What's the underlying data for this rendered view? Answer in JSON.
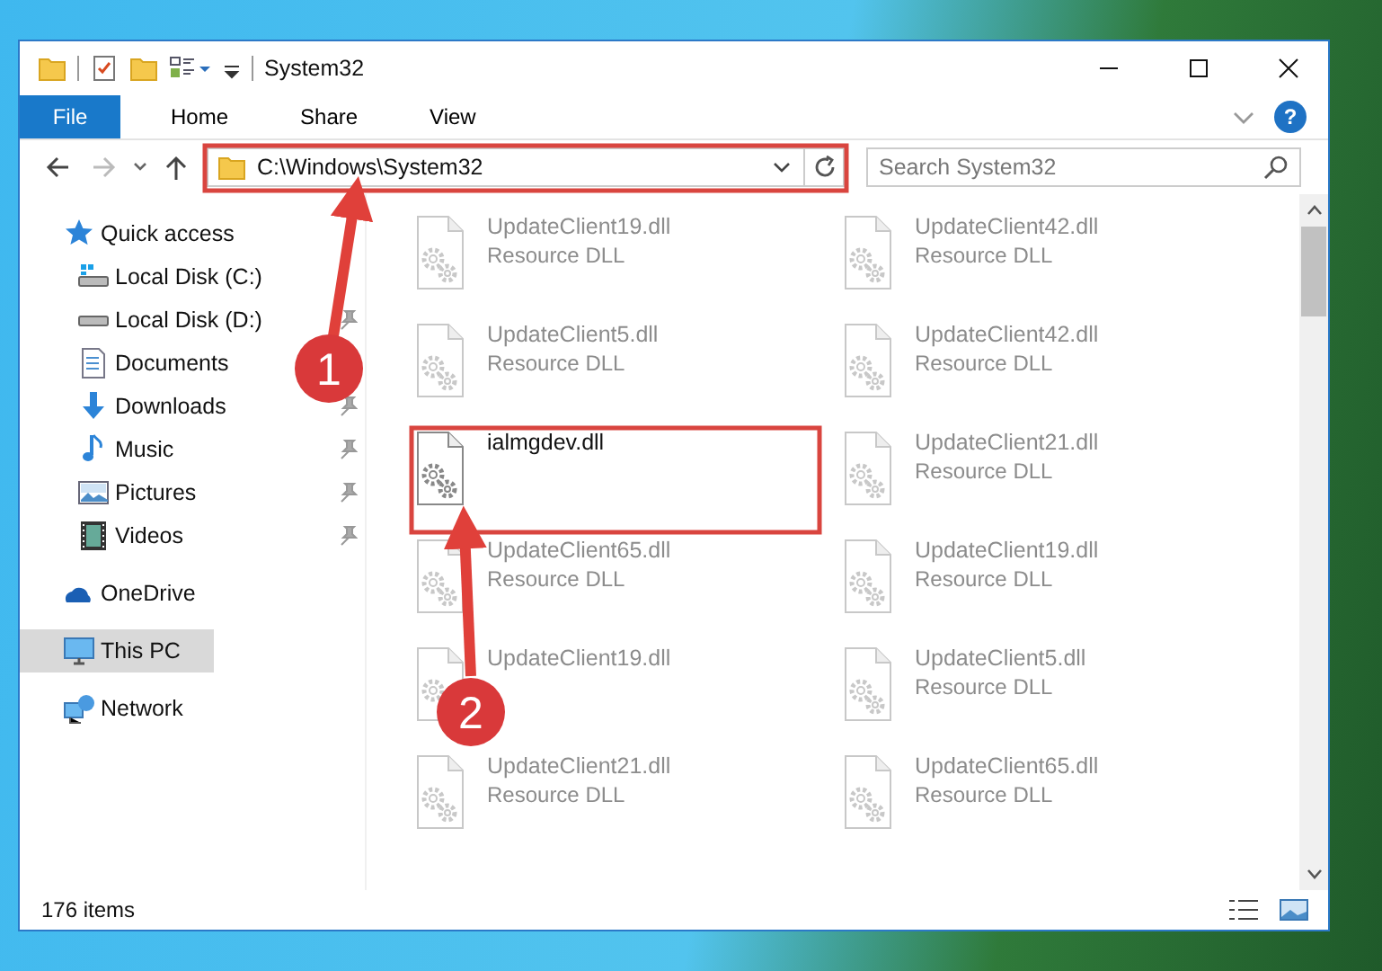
{
  "window": {
    "title": "System32"
  },
  "ribbon_tabs": [
    {
      "label": "File",
      "kind": "file"
    },
    {
      "label": "Home",
      "kind": "tab"
    },
    {
      "label": "Share",
      "kind": "tab"
    },
    {
      "label": "View",
      "kind": "tab"
    }
  ],
  "help_button": {
    "label": "?"
  },
  "address_bar": {
    "path": "C:\\Windows\\System32"
  },
  "search": {
    "placeholder": "Search System32"
  },
  "sidebar": {
    "items": [
      {
        "label": "Quick access",
        "kind": "star",
        "selected": false,
        "children": [
          {
            "label": "Local Disk (C:)",
            "kind": "drive-c",
            "pinned": false
          },
          {
            "label": "Local Disk (D:)",
            "kind": "drive",
            "pinned": true
          },
          {
            "label": "Documents",
            "kind": "documents",
            "pinned": false
          },
          {
            "label": "Downloads",
            "kind": "downloads",
            "pinned": true
          },
          {
            "label": "Music",
            "kind": "music",
            "pinned": true
          },
          {
            "label": "Pictures",
            "kind": "pictures",
            "pinned": true
          },
          {
            "label": "Videos",
            "kind": "videos",
            "pinned": true
          }
        ]
      },
      {
        "label": "OneDrive",
        "kind": "cloud",
        "selected": false
      },
      {
        "label": "This PC",
        "kind": "pc",
        "selected": true
      },
      {
        "label": "Network",
        "kind": "network",
        "selected": false
      }
    ]
  },
  "files": [
    {
      "name": "UpdateClient19.dll",
      "type": "Resource DLL",
      "blurred": true
    },
    {
      "name": "UpdateClient42.dll",
      "type": "Resource DLL",
      "blurred": true
    },
    {
      "name": "UpdateClient5.dll",
      "type": "Resource DLL",
      "blurred": true
    },
    {
      "name": "UpdateClient42.dll",
      "type": "Resource DLL",
      "blurred": true
    },
    {
      "name": "ialmgdev.dll",
      "blurred": false
    },
    {
      "name": "UpdateClient21.dll",
      "type": "Resource DLL",
      "blurred": true
    },
    {
      "name": "UpdateClient65.dll",
      "type": "Resource DLL",
      "blurred": true
    },
    {
      "name": "UpdateClient19.dll",
      "type": "Resource DLL",
      "blurred": true
    },
    {
      "name": "UpdateClient19.dll",
      "blurred": true
    },
    {
      "name": "UpdateClient5.dll",
      "type": "Resource DLL",
      "blurred": true
    },
    {
      "name": "UpdateClient21.dll",
      "type": "Resource DLL",
      "blurred": true
    },
    {
      "name": "UpdateClient65.dll",
      "type": "Resource DLL",
      "blurred": true
    }
  ],
  "status_bar": {
    "item_count": "176 items"
  },
  "annotations": [
    {
      "number": "1"
    },
    {
      "number": "2"
    }
  ]
}
